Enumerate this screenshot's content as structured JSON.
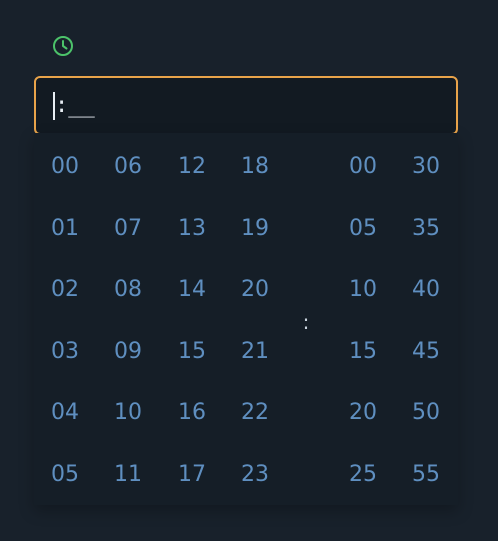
{
  "icons": {
    "clock": "clock-icon"
  },
  "input": {
    "mask": ":__"
  },
  "picker": {
    "separator": ":",
    "hours": [
      [
        "00",
        "06",
        "12",
        "18"
      ],
      [
        "01",
        "07",
        "13",
        "19"
      ],
      [
        "02",
        "08",
        "14",
        "20"
      ],
      [
        "03",
        "09",
        "15",
        "21"
      ],
      [
        "04",
        "10",
        "16",
        "22"
      ],
      [
        "05",
        "11",
        "17",
        "23"
      ]
    ],
    "minutes": [
      [
        "00",
        "30"
      ],
      [
        "05",
        "35"
      ],
      [
        "10",
        "40"
      ],
      [
        "15",
        "45"
      ],
      [
        "20",
        "50"
      ],
      [
        "25",
        "55"
      ]
    ]
  },
  "colors": {
    "background": "#18212b",
    "input_border": "#e8a34a",
    "value_text": "#5f8fc0",
    "clock_icon": "#4cc36a"
  }
}
